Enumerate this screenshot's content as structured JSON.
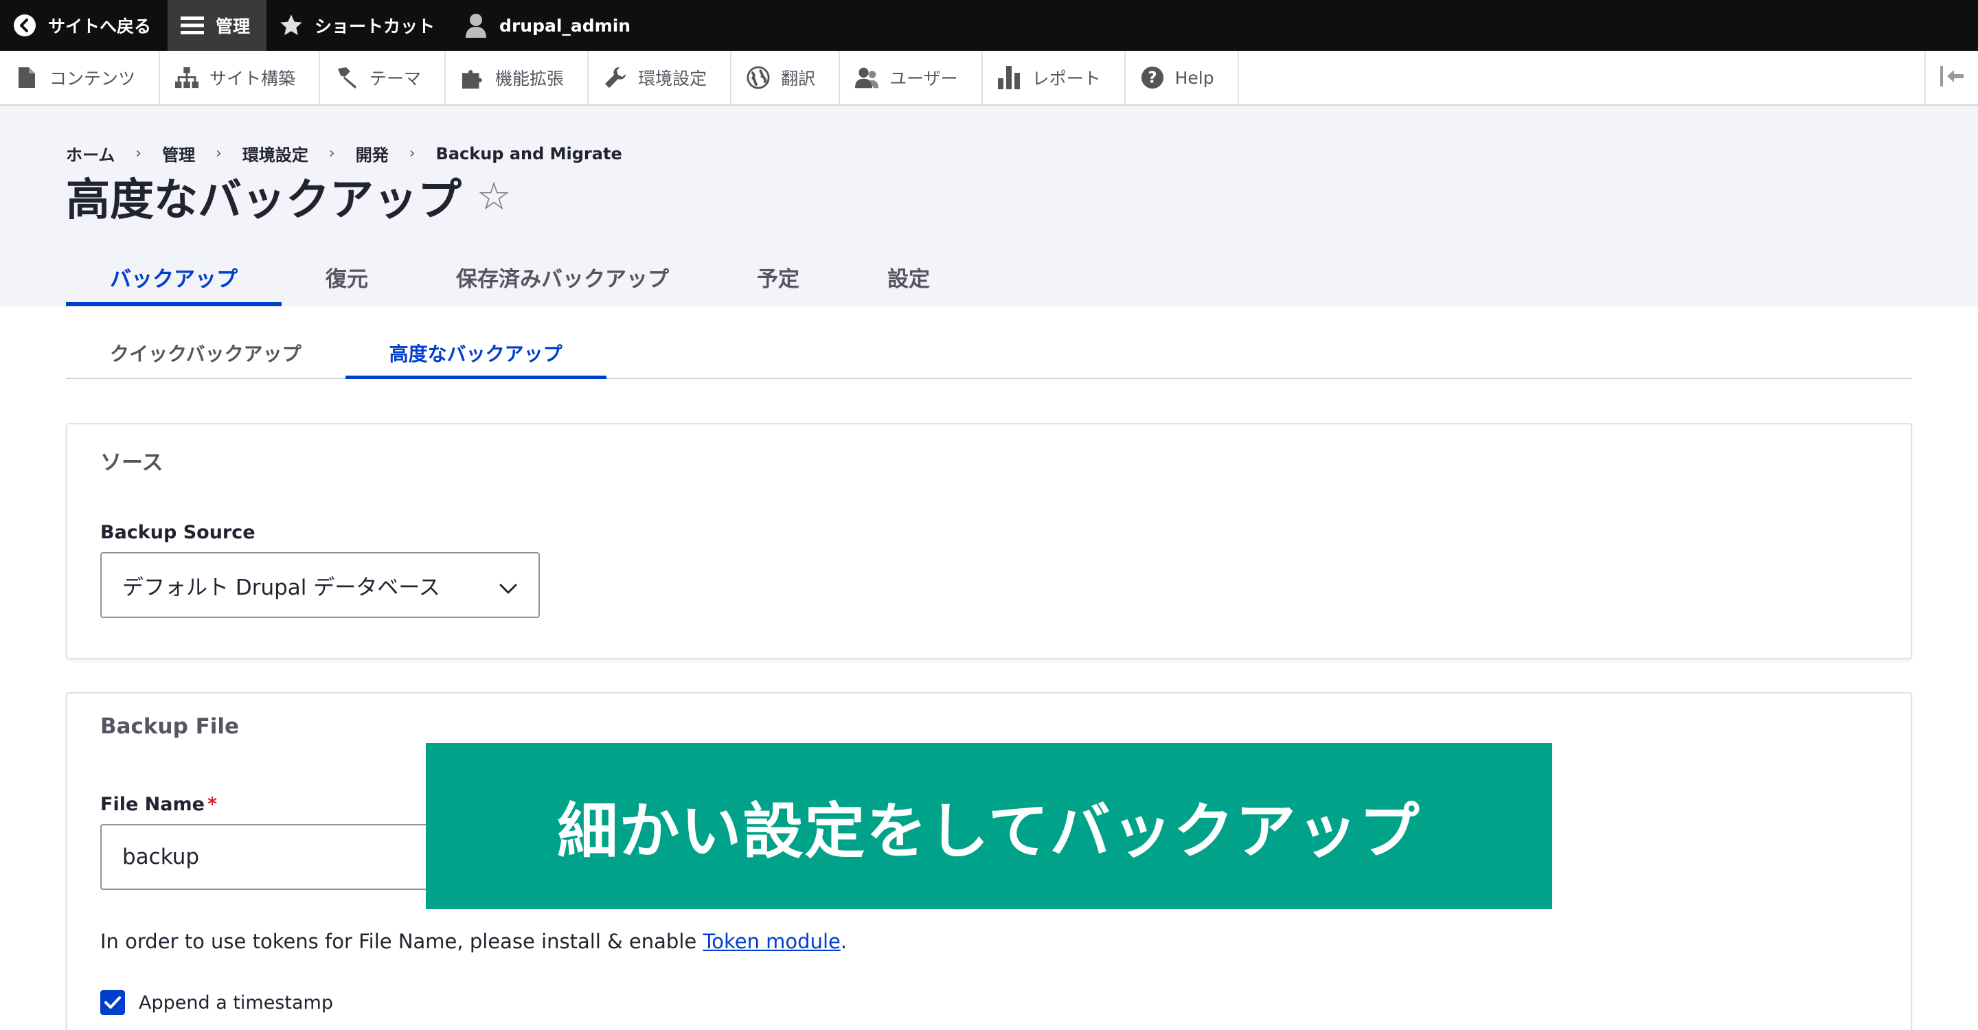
{
  "toolbar": {
    "back_label": "サイトへ戻る",
    "manage_label": "管理",
    "shortcuts_label": "ショートカット",
    "user_label": "drupal_admin"
  },
  "tray": {
    "items": [
      {
        "label": "コンテンツ",
        "icon": "file-icon"
      },
      {
        "label": "サイト構築",
        "icon": "sitemap-icon"
      },
      {
        "label": "テーマ",
        "icon": "paint-brush-icon"
      },
      {
        "label": "機能拡張",
        "icon": "puzzle-icon"
      },
      {
        "label": "環境設定",
        "icon": "wrench-icon"
      },
      {
        "label": "翻訳",
        "icon": "globe-icon"
      },
      {
        "label": "ユーザー",
        "icon": "users-icon"
      },
      {
        "label": "レポート",
        "icon": "bar-chart-icon"
      },
      {
        "label": "Help",
        "icon": "help-icon"
      }
    ]
  },
  "breadcrumb": [
    "ホーム",
    "管理",
    "環境設定",
    "開発",
    "Backup and Migrate"
  ],
  "page": {
    "title": "高度なバックアップ",
    "star": "☆"
  },
  "primary_tabs": [
    "バックアップ",
    "復元",
    "保存済みバックアップ",
    "予定",
    "設定"
  ],
  "secondary_tabs": [
    "クイックバックアップ",
    "高度なバックアップ"
  ],
  "source_section": {
    "legend": "ソース",
    "label": "Backup Source",
    "selected": "デフォルト Drupal データベース"
  },
  "file_section": {
    "legend": "Backup File",
    "label": "File Name",
    "required_mark": "*",
    "value": "backup",
    "help_prefix": "In order to use tokens for File Name, please install & enable ",
    "help_link": "Token module",
    "help_suffix": ".",
    "checkbox_label": "Append a timestamp"
  },
  "banner": {
    "text": "細かい設定をしてバックアップ"
  },
  "colors": {
    "accent": "#003ecc",
    "banner": "#00a38a",
    "toolbar": "#0f0f0f"
  }
}
